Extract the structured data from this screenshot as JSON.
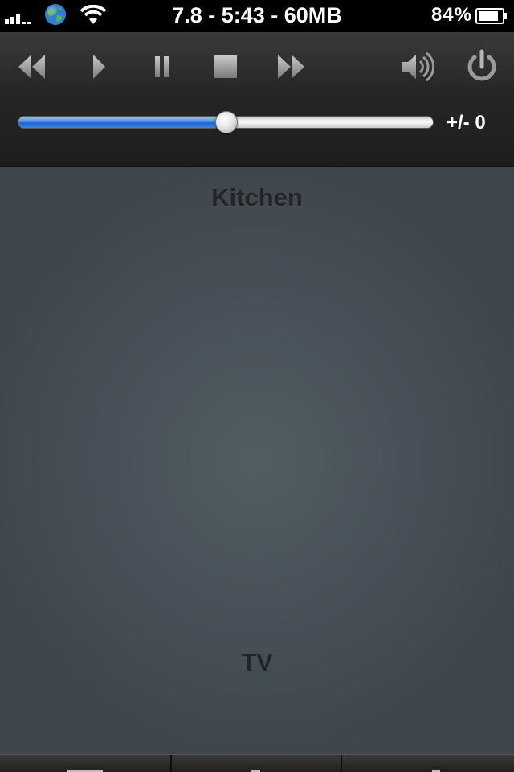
{
  "status_bar": {
    "center_text": "7.8 - 5:43 - 60MB",
    "battery_percent": "84%",
    "battery_level": 0.84,
    "icons": [
      "signal-bars-icon",
      "globe-icon",
      "wifi-icon",
      "battery-icon"
    ]
  },
  "controls": {
    "buttons": [
      {
        "name": "rewind",
        "icon": "rewind-icon"
      },
      {
        "name": "play",
        "icon": "play-icon"
      },
      {
        "name": "pause",
        "icon": "pause-icon"
      },
      {
        "name": "stop",
        "icon": "stop-icon"
      },
      {
        "name": "fast-forward",
        "icon": "fast-forward-icon"
      },
      {
        "name": "volume",
        "icon": "speaker-icon"
      },
      {
        "name": "power",
        "icon": "power-icon"
      }
    ],
    "volume_slider_level": 0.5,
    "volume_label": "+/- 0"
  },
  "zones": {
    "top_label": "Kitchen",
    "bottom_label": "TV"
  },
  "tab_bar": {
    "tabs": [
      "tab-1",
      "tab-2",
      "tab-3"
    ]
  },
  "colors": {
    "accent_blue": "#2f74dc",
    "panel_dark": "#262626",
    "background": "#49525a",
    "icon_gray": "#9a9a9a"
  }
}
